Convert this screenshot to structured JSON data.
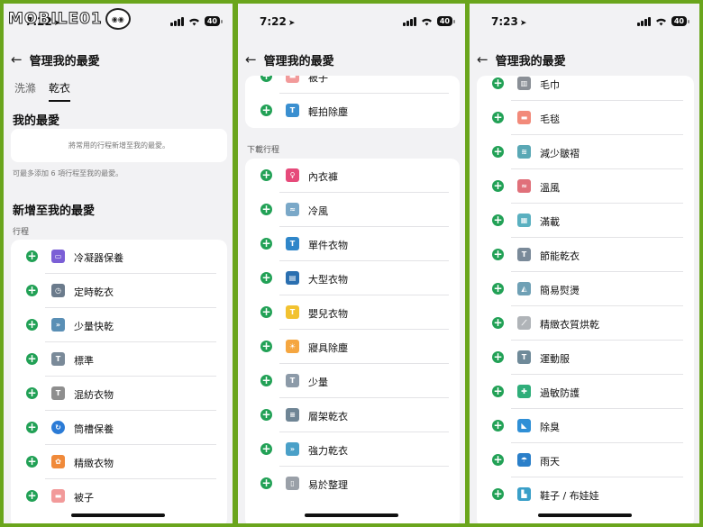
{
  "watermark": "MOBILE01",
  "panels": [
    {
      "time": "7:22",
      "battery": "40",
      "title": "管理我的最愛",
      "tabs": [
        "洗滌",
        "乾衣"
      ],
      "favorites_title": "我的最愛",
      "favorites_empty": "將常用的行程新增至我的最愛。",
      "favorites_note": "可最多添加 6 項行程至我的最愛。",
      "add_title": "新增至我的最愛",
      "course_label": "行程",
      "items": [
        "冷凝器保養",
        "定時乾衣",
        "少量快乾",
        "標準",
        "混紡衣物",
        "筒槽保養",
        "精緻衣物",
        "被子"
      ]
    },
    {
      "time": "7:22",
      "battery": "40",
      "title": "管理我的最愛",
      "top_items": [
        "被子",
        "輕拍除塵"
      ],
      "download_label": "下載行程",
      "items": [
        "內衣褲",
        "冷風",
        "單件衣物",
        "大型衣物",
        "嬰兒衣物",
        "寢具除塵",
        "少量",
        "層架乾衣",
        "強力乾衣",
        "易於整理"
      ]
    },
    {
      "time": "7:23",
      "battery": "40",
      "title": "管理我的最愛",
      "items": [
        "毛巾",
        "毛毯",
        "減少皺褶",
        "溫風",
        "滿載",
        "節能乾衣",
        "簡易熨燙",
        "精緻衣質烘乾",
        "運動服",
        "過敏防護",
        "除臭",
        "雨天",
        "鞋子 / 布娃娃"
      ]
    }
  ],
  "colors": {
    "accent_green": "#22a156",
    "frame_green": "#6aa51c"
  }
}
